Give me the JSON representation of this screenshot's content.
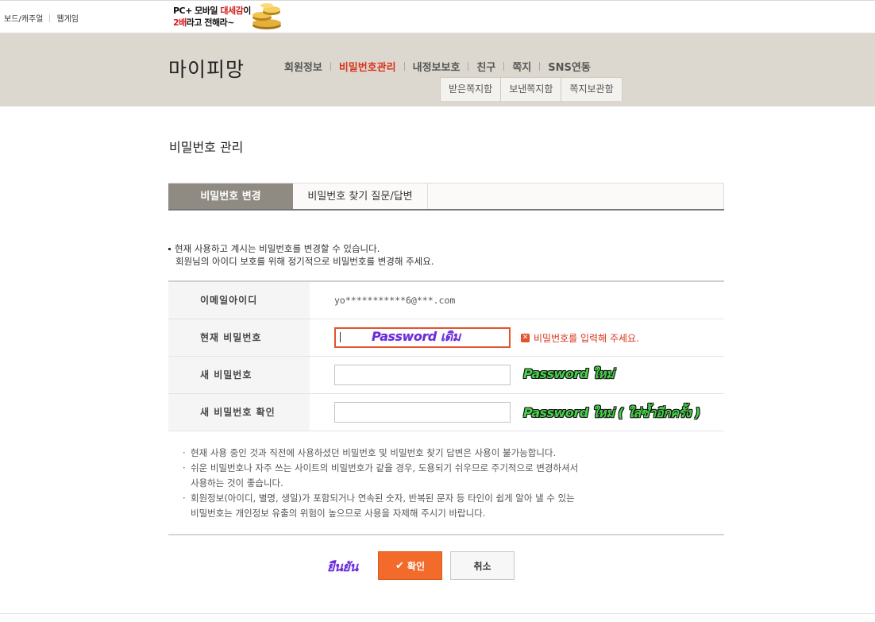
{
  "top": {
    "links": [
      "보드/캐주얼",
      "웹게임"
    ],
    "promo": {
      "line1_a": "PC+ 모바일 ",
      "line1_b": "대세감",
      "line1_c": "이",
      "line2_a": "2배",
      "line2_b": "라고 전해라~"
    }
  },
  "header": {
    "title": "마이피망",
    "nav": [
      "회원정보",
      "비밀번호관리",
      "내정보보호",
      "친구",
      "쪽지",
      "SNS연동"
    ],
    "active_nav": "비밀번호관리",
    "subnav": [
      "받은쪽지함",
      "보낸쪽지함",
      "쪽지보관함"
    ]
  },
  "main": {
    "title": "비밀번호 관리",
    "tabs": [
      "비밀번호 변경",
      "비밀번호 찾기 질문/답변"
    ],
    "desc": [
      "현재 사용하고 계시는 비밀번호를 변경할 수 있습니다.",
      "회원님의 아이디 보호를 위해 정기적으로 비밀번호를 변경해 주세요."
    ],
    "form": {
      "email_label": "이메일아이디",
      "email_value": "yo***********6@***.com",
      "current_label": "현재 비밀번호",
      "current_error": "비밀번호를 입력해 주세요.",
      "new_label": "새 비밀번호",
      "confirm_label": "새 비밀번호 확인"
    },
    "notes": [
      "현재 사용 중인 것과 직전에 사용하셨던 비밀번호 및 비밀번호 찾기 답변은 사용이 불가능합니다.",
      "쉬운 비밀번호나 자주 쓰는 사이트의 비밀번호가 같을 경우, 도용되기 쉬우므로 주기적으로 변경하셔서",
      "사용하는 것이 좋습니다.",
      "회원정보(아이디, 별명, 생일)가 포함되거나 연속된 숫자, 반복된 문자 등 타인이 쉽게 알아 낼 수 있는",
      "비밀번호는 개인정보 유출의 위험이 높으므로 사용을 자제해 주시기 바랍니다."
    ],
    "buttons": {
      "confirm": "확인",
      "cancel": "취소"
    }
  },
  "annotations": {
    "current": "Password เดิม",
    "new": "Password ใหม่",
    "confirm": "Password ใหม่ ( ใส่ซ้ำอีกครั้ง )",
    "submit": "ยืนยัน"
  },
  "colors": {
    "accent": "#d9341b",
    "button": "#f26b2a",
    "band": "#dcd8d0",
    "tab_active": "#8f8a82"
  }
}
